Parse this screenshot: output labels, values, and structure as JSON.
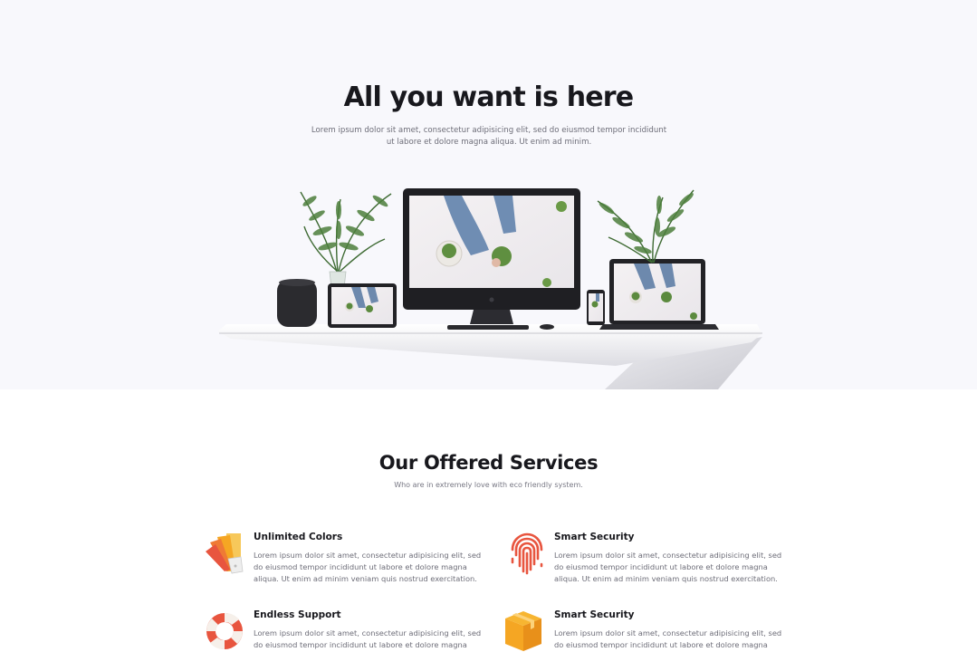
{
  "hero": {
    "title": "All you want is here",
    "description": "Lorem ipsum dolor sit amet, consectetur adipisicing elit, sed do eiusmod tempor incididunt ut labore et dolore magna aliqua. Ut enim ad minim."
  },
  "services": {
    "title": "Our Offered Services",
    "subtitle": "Who are in extremely love with eco friendly system.",
    "items": [
      {
        "title": "Unlimited Colors",
        "description": "Lorem ipsum dolor sit amet, consectetur adipisicing elit, sed do eiusmod tempor incididunt ut labore et dolore magna aliqua. Ut enim ad minim veniam quis nostrud exercitation.",
        "icon": "color-palette-icon"
      },
      {
        "title": "Smart Security",
        "description": "Lorem ipsum dolor sit amet, consectetur adipisicing elit, sed do eiusmod tempor incididunt ut labore et dolore magna aliqua. Ut enim ad minim veniam quis nostrud exercitation.",
        "icon": "fingerprint-icon"
      },
      {
        "title": "Endless Support",
        "description": "Lorem ipsum dolor sit amet, consectetur adipisicing elit, sed do eiusmod tempor incididunt ut labore et dolore magna aliqua.",
        "icon": "lifebuoy-icon"
      },
      {
        "title": "Smart Security",
        "description": "Lorem ipsum dolor sit amet, consectetur adipisicing elit, sed do eiusmod tempor incididunt ut labore et dolore magna aliqua.",
        "icon": "box-icon"
      }
    ]
  },
  "colors": {
    "hero_bg": "#f8f8fc",
    "heading": "#18181d",
    "body_text": "#6d6d78",
    "accent_red": "#e8553f",
    "accent_orange": "#f5a623"
  }
}
